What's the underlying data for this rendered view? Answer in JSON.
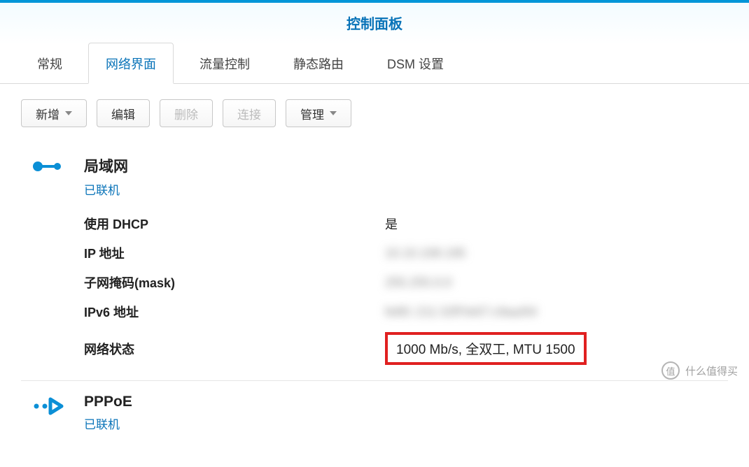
{
  "window": {
    "title": "控制面板"
  },
  "tabs": [
    {
      "label": "常规",
      "active": false
    },
    {
      "label": "网络界面",
      "active": true
    },
    {
      "label": "流量控制",
      "active": false
    },
    {
      "label": "静态路由",
      "active": false
    },
    {
      "label": "DSM 设置",
      "active": false
    }
  ],
  "toolbar": {
    "add": "新增",
    "edit": "编辑",
    "delete": "删除",
    "connect": "连接",
    "manage": "管理"
  },
  "interfaces": [
    {
      "name": "局域网",
      "status": "已联机",
      "icon": "lan",
      "details": {
        "dhcp_label": "使用 DHCP",
        "dhcp_value": "是",
        "ip_label": "IP 地址",
        "ip_value": "10.10.108.195",
        "mask_label": "子网掩码(mask)",
        "mask_value": "255.255.0.0",
        "ipv6_label": "IPv6 地址",
        "ipv6_value": "fe80::211:32ff:fe67:c9aa/64",
        "netstat_label": "网络状态",
        "netstat_value": "1000 Mb/s, 全双工, MTU 1500"
      }
    },
    {
      "name": "PPPoE",
      "status": "已联机",
      "icon": "pppoe"
    }
  ],
  "watermark": {
    "symbol": "值",
    "text": "什么值得买"
  }
}
